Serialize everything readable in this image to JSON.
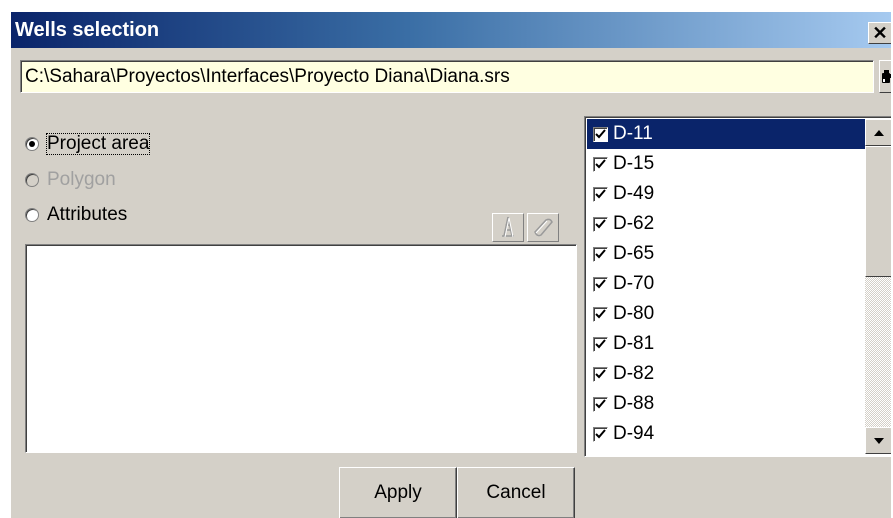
{
  "window": {
    "title": "Wells selection"
  },
  "project_path": "C:\\Sahara\\Proyectos\\Interfaces\\Proyecto Diana\\Diana.srs",
  "selection_mode": {
    "options": [
      {
        "label": "Project area",
        "selected": true,
        "enabled": true
      },
      {
        "label": "Polygon",
        "selected": false,
        "enabled": false
      },
      {
        "label": "Attributes",
        "selected": false,
        "enabled": true
      }
    ]
  },
  "toolbar": {
    "well_tool_icon": "oil-rig-icon",
    "eraser_tool_icon": "eraser-icon"
  },
  "wells": [
    {
      "label": "D-11",
      "checked": true,
      "selected": true
    },
    {
      "label": "D-15",
      "checked": true,
      "selected": false
    },
    {
      "label": "D-49",
      "checked": true,
      "selected": false
    },
    {
      "label": "D-62",
      "checked": true,
      "selected": false
    },
    {
      "label": "D-65",
      "checked": true,
      "selected": false
    },
    {
      "label": "D-70",
      "checked": true,
      "selected": false
    },
    {
      "label": "D-80",
      "checked": true,
      "selected": false
    },
    {
      "label": "D-81",
      "checked": true,
      "selected": false
    },
    {
      "label": "D-82",
      "checked": true,
      "selected": false
    },
    {
      "label": "D-88",
      "checked": true,
      "selected": false
    },
    {
      "label": "D-94",
      "checked": true,
      "selected": false
    }
  ],
  "buttons": {
    "apply": "Apply",
    "cancel": "Cancel"
  },
  "colors": {
    "selection": "#0a246a",
    "path_background": "#ffffe1",
    "face": "#d4d0c8"
  }
}
